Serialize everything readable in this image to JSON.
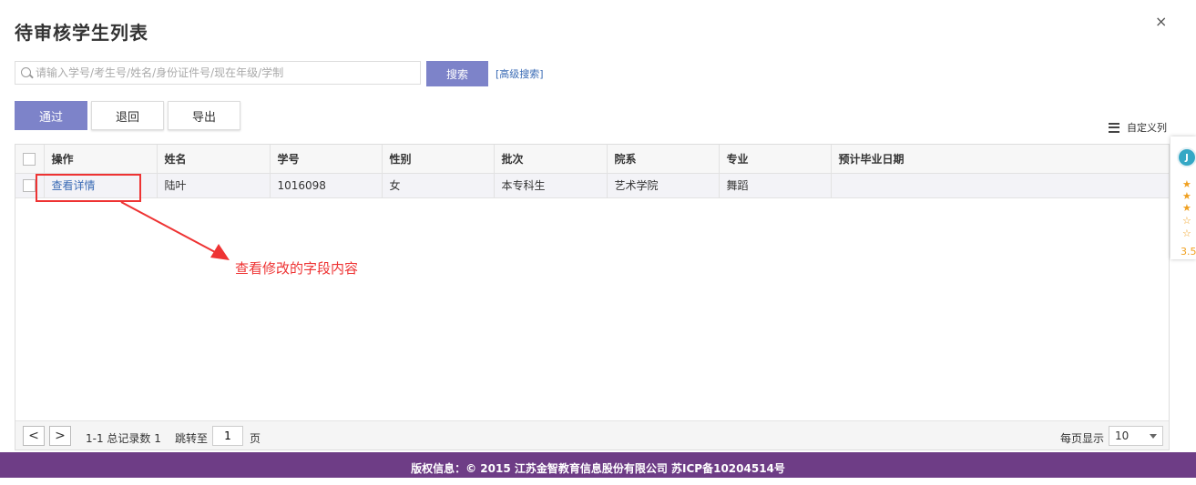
{
  "dialog": {
    "title": "待审核学生列表",
    "close": "×"
  },
  "search": {
    "placeholder": "请输入学号/考生号/姓名/身份证件号/现在年级/学制",
    "value": "",
    "button": "搜索",
    "advanced": "[高级搜索]"
  },
  "actions": {
    "pass": "通过",
    "back": "退回",
    "export": "导出",
    "custom_columns": "自定义列"
  },
  "table": {
    "columns": [
      "操作",
      "姓名",
      "学号",
      "性别",
      "批次",
      "院系",
      "专业",
      "预计毕业日期"
    ],
    "rows": [
      {
        "action": "查看详情",
        "name": "陆叶",
        "student_id": "1016098",
        "gender": "女",
        "batch": "本专科生",
        "department": "艺术学院",
        "major": "舞蹈",
        "graduation": ""
      }
    ]
  },
  "annotation": {
    "text": "查看修改的字段内容",
    "color": "#e33333"
  },
  "pager": {
    "prev": "<",
    "next": ">",
    "summary": "1-1 总记录数 1",
    "jump_label": "跳转至",
    "jump_value": "1",
    "page_unit": "页",
    "per_page_label": "每页显示",
    "per_page": "10"
  },
  "footer": {
    "text": "版权信息：© 2015 江苏金智教育信息股份有限公司 苏ICP备10204514号"
  },
  "side_widget": {
    "rating": "3.5",
    "stars_filled": 3,
    "stars_total": 5
  },
  "colors": {
    "primary": "#7d83c9",
    "link": "#3a6bb5",
    "footer_bg": "#6e3d86",
    "annotation": "#e33333"
  }
}
